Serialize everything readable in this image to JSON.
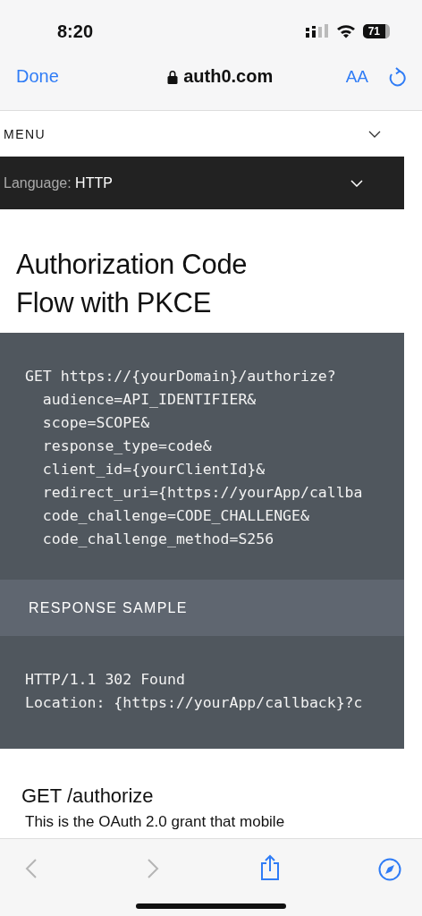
{
  "status_bar": {
    "time": "8:20",
    "battery": "71"
  },
  "browser": {
    "done": "Done",
    "domain": "auth0.com",
    "text_size": "AA"
  },
  "menu": {
    "label": "MENU",
    "expanded": false
  },
  "language": {
    "label": "Language:",
    "value": "HTTP",
    "expanded": false
  },
  "title": "Authorization Code Flow with PKCE",
  "request_code": [
    "GET https://{yourDomain}/authorize?",
    "  audience=API_IDENTIFIER&",
    "  scope=SCOPE&",
    "  response_type=code&",
    "  client_id={yourClientId}&",
    "  redirect_uri={https://yourApp/callba",
    "  code_challenge=CODE_CHALLENGE&",
    "  code_challenge_method=S256"
  ],
  "response_heading": "RESPONSE SAMPLE",
  "response_code": [
    "HTTP/1.1 302 Found",
    "Location: {https://yourApp/callback}?c"
  ],
  "section_heading": "GET /authorize",
  "paragraph": "This is the OAuth 2.0 grant that mobile",
  "toolbar": {
    "back_disabled": true,
    "forward_disabled": true
  }
}
